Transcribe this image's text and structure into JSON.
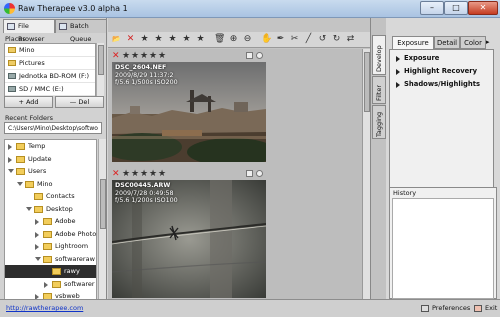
{
  "window": {
    "title": "Raw Therapee v3.0 alpha 1",
    "minimize": "–",
    "maximize": "□",
    "close": "✕"
  },
  "left_tabs": [
    {
      "label": "File Browser"
    },
    {
      "label": "Batch Queue"
    }
  ],
  "places": {
    "label": "Places",
    "items": [
      "Mino",
      "Pictures"
    ],
    "drives": [
      "Jednotka BD-ROM (F:)",
      "SD / MMC (E:)"
    ],
    "add_label": "Add",
    "del_label": "Del"
  },
  "recent": {
    "label": "Recent Folders",
    "value": "C:\\Users\\Mino\\Desktop\\softwo"
  },
  "tree": [
    {
      "label": "Temp",
      "level": 1,
      "expanded": false
    },
    {
      "label": "Update",
      "level": 1,
      "expanded": false
    },
    {
      "label": "Users",
      "level": 1,
      "expanded": true
    },
    {
      "label": "Mino",
      "level": 2,
      "expanded": true
    },
    {
      "label": "Contacts",
      "level": 3,
      "expanded": null
    },
    {
      "label": "Desktop",
      "level": 3,
      "expanded": true
    },
    {
      "label": "Adobe",
      "level": 4,
      "expanded": false
    },
    {
      "label": "Adobe Photo",
      "level": 4,
      "expanded": false
    },
    {
      "label": "Lightroom",
      "level": 4,
      "expanded": false
    },
    {
      "label": "softwareraw",
      "level": 4,
      "expanded": true
    },
    {
      "label": "rawy",
      "level": 5,
      "expanded": null,
      "selected": true
    },
    {
      "label": "softwarer",
      "level": 5,
      "expanded": false
    },
    {
      "label": "vsbweb",
      "level": 4,
      "expanded": false
    },
    {
      "label": "Documents",
      "level": 3,
      "expanded": false
    }
  ],
  "toolbar": {
    "icons": [
      "folder-icon",
      "reject-icon",
      "star-icon",
      "star-icon",
      "star-icon",
      "star-icon",
      "star-icon",
      "trash-icon",
      "zoom-in-icon",
      "zoom-out-icon",
      "hand-icon",
      "eyedropper-icon",
      "crop-icon",
      "straighten-icon",
      "rotate-left-icon",
      "rotate-right-icon",
      "flip-icon"
    ]
  },
  "thumbnails": [
    {
      "filename": "DSC_2604.NEF",
      "date": "2009/8/29 11:37:2",
      "exposure": "f/5.6 1/500s ISO200"
    },
    {
      "filename": "DSC00445.ARW",
      "date": "2009/7/28 0:49:58",
      "exposure": "f/5.6 1/200s ISO100"
    }
  ],
  "right_vtabs": [
    "Develop",
    "Filter",
    "Tagging"
  ],
  "right_tabs": [
    "Exposure",
    "Detail",
    "Color"
  ],
  "sections": [
    "Exposure",
    "Highlight Recovery",
    "Shadows/Highlights"
  ],
  "history": {
    "label": "History"
  },
  "status": {
    "link": "http://rawtherapee.com",
    "preferences": "Preferences",
    "exit": "Exit"
  },
  "colors": {
    "selection": "#2d2d2d",
    "link": "#1034c8",
    "reject": "#d22222"
  }
}
